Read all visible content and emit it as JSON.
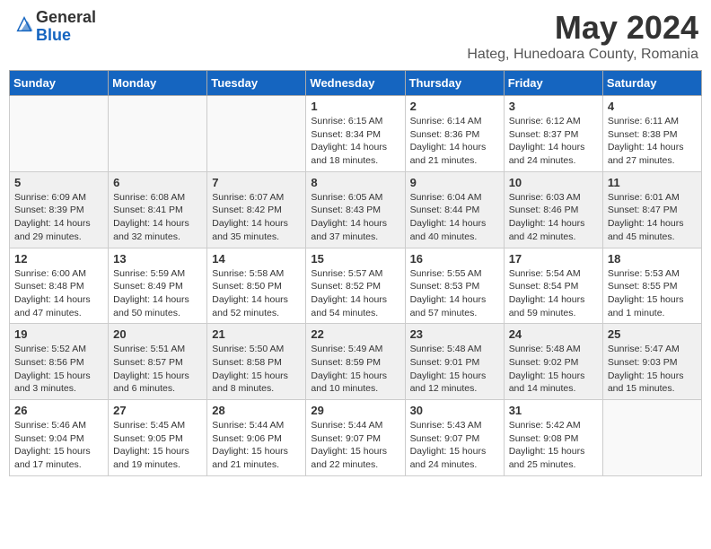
{
  "header": {
    "logo_general": "General",
    "logo_blue": "Blue",
    "month_title": "May 2024",
    "subtitle": "Hateg, Hunedoara County, Romania"
  },
  "weekdays": [
    "Sunday",
    "Monday",
    "Tuesday",
    "Wednesday",
    "Thursday",
    "Friday",
    "Saturday"
  ],
  "weeks": [
    [
      {
        "day": "",
        "info": ""
      },
      {
        "day": "",
        "info": ""
      },
      {
        "day": "",
        "info": ""
      },
      {
        "day": "1",
        "info": "Sunrise: 6:15 AM\nSunset: 8:34 PM\nDaylight: 14 hours\nand 18 minutes."
      },
      {
        "day": "2",
        "info": "Sunrise: 6:14 AM\nSunset: 8:36 PM\nDaylight: 14 hours\nand 21 minutes."
      },
      {
        "day": "3",
        "info": "Sunrise: 6:12 AM\nSunset: 8:37 PM\nDaylight: 14 hours\nand 24 minutes."
      },
      {
        "day": "4",
        "info": "Sunrise: 6:11 AM\nSunset: 8:38 PM\nDaylight: 14 hours\nand 27 minutes."
      }
    ],
    [
      {
        "day": "5",
        "info": "Sunrise: 6:09 AM\nSunset: 8:39 PM\nDaylight: 14 hours\nand 29 minutes."
      },
      {
        "day": "6",
        "info": "Sunrise: 6:08 AM\nSunset: 8:41 PM\nDaylight: 14 hours\nand 32 minutes."
      },
      {
        "day": "7",
        "info": "Sunrise: 6:07 AM\nSunset: 8:42 PM\nDaylight: 14 hours\nand 35 minutes."
      },
      {
        "day": "8",
        "info": "Sunrise: 6:05 AM\nSunset: 8:43 PM\nDaylight: 14 hours\nand 37 minutes."
      },
      {
        "day": "9",
        "info": "Sunrise: 6:04 AM\nSunset: 8:44 PM\nDaylight: 14 hours\nand 40 minutes."
      },
      {
        "day": "10",
        "info": "Sunrise: 6:03 AM\nSunset: 8:46 PM\nDaylight: 14 hours\nand 42 minutes."
      },
      {
        "day": "11",
        "info": "Sunrise: 6:01 AM\nSunset: 8:47 PM\nDaylight: 14 hours\nand 45 minutes."
      }
    ],
    [
      {
        "day": "12",
        "info": "Sunrise: 6:00 AM\nSunset: 8:48 PM\nDaylight: 14 hours\nand 47 minutes."
      },
      {
        "day": "13",
        "info": "Sunrise: 5:59 AM\nSunset: 8:49 PM\nDaylight: 14 hours\nand 50 minutes."
      },
      {
        "day": "14",
        "info": "Sunrise: 5:58 AM\nSunset: 8:50 PM\nDaylight: 14 hours\nand 52 minutes."
      },
      {
        "day": "15",
        "info": "Sunrise: 5:57 AM\nSunset: 8:52 PM\nDaylight: 14 hours\nand 54 minutes."
      },
      {
        "day": "16",
        "info": "Sunrise: 5:55 AM\nSunset: 8:53 PM\nDaylight: 14 hours\nand 57 minutes."
      },
      {
        "day": "17",
        "info": "Sunrise: 5:54 AM\nSunset: 8:54 PM\nDaylight: 14 hours\nand 59 minutes."
      },
      {
        "day": "18",
        "info": "Sunrise: 5:53 AM\nSunset: 8:55 PM\nDaylight: 15 hours\nand 1 minute."
      }
    ],
    [
      {
        "day": "19",
        "info": "Sunrise: 5:52 AM\nSunset: 8:56 PM\nDaylight: 15 hours\nand 3 minutes."
      },
      {
        "day": "20",
        "info": "Sunrise: 5:51 AM\nSunset: 8:57 PM\nDaylight: 15 hours\nand 6 minutes."
      },
      {
        "day": "21",
        "info": "Sunrise: 5:50 AM\nSunset: 8:58 PM\nDaylight: 15 hours\nand 8 minutes."
      },
      {
        "day": "22",
        "info": "Sunrise: 5:49 AM\nSunset: 8:59 PM\nDaylight: 15 hours\nand 10 minutes."
      },
      {
        "day": "23",
        "info": "Sunrise: 5:48 AM\nSunset: 9:01 PM\nDaylight: 15 hours\nand 12 minutes."
      },
      {
        "day": "24",
        "info": "Sunrise: 5:48 AM\nSunset: 9:02 PM\nDaylight: 15 hours\nand 14 minutes."
      },
      {
        "day": "25",
        "info": "Sunrise: 5:47 AM\nSunset: 9:03 PM\nDaylight: 15 hours\nand 15 minutes."
      }
    ],
    [
      {
        "day": "26",
        "info": "Sunrise: 5:46 AM\nSunset: 9:04 PM\nDaylight: 15 hours\nand 17 minutes."
      },
      {
        "day": "27",
        "info": "Sunrise: 5:45 AM\nSunset: 9:05 PM\nDaylight: 15 hours\nand 19 minutes."
      },
      {
        "day": "28",
        "info": "Sunrise: 5:44 AM\nSunset: 9:06 PM\nDaylight: 15 hours\nand 21 minutes."
      },
      {
        "day": "29",
        "info": "Sunrise: 5:44 AM\nSunset: 9:07 PM\nDaylight: 15 hours\nand 22 minutes."
      },
      {
        "day": "30",
        "info": "Sunrise: 5:43 AM\nSunset: 9:07 PM\nDaylight: 15 hours\nand 24 minutes."
      },
      {
        "day": "31",
        "info": "Sunrise: 5:42 AM\nSunset: 9:08 PM\nDaylight: 15 hours\nand 25 minutes."
      },
      {
        "day": "",
        "info": ""
      }
    ]
  ]
}
